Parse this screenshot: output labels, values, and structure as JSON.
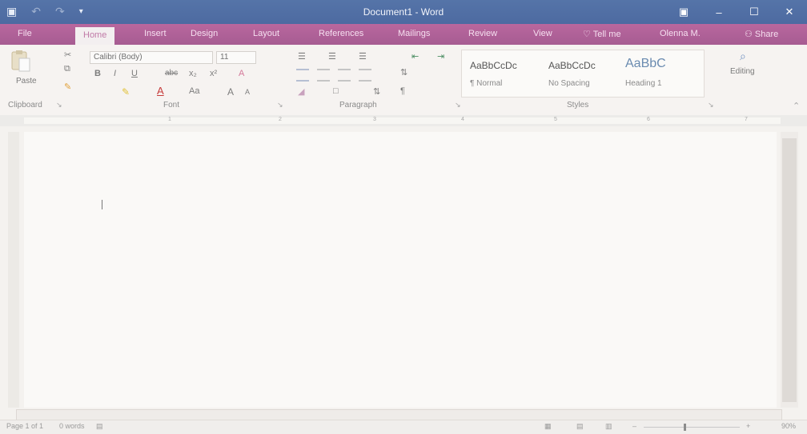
{
  "window": {
    "title": "Document1 - Word",
    "qat_save_icon": "▣",
    "qat_undo_icon": "↶",
    "qat_redo_icon": "↷",
    "qat_more_icon": "▾",
    "minimize_icon": "–",
    "restore_icon": "☐",
    "close_icon": "✕",
    "ribbon_display_icon": "▣"
  },
  "tabs": [
    "File",
    "Home",
    "Insert",
    "Design",
    "Layout",
    "References",
    "Mailings",
    "Review",
    "View"
  ],
  "tell_me": "♡ Tell me",
  "user": "Olenna M.",
  "share": "⚇ Share",
  "clipboard": {
    "paste": "Paste",
    "group": "Clipboard"
  },
  "font": {
    "name": "Calibri (Body)",
    "size": "11",
    "bold": "B",
    "italic": "I",
    "underline": "U",
    "strike": "abc",
    "sub": "x₂",
    "sup": "x²",
    "clear": "A",
    "case": "Aa",
    "grow": "A",
    "shrink": "A",
    "group": "Font"
  },
  "paragraph": {
    "bullets": "☰",
    "numbering": "☰",
    "multilevel": "☰",
    "outdent": "⇤",
    "indent": "⇥",
    "pilcrow": "¶",
    "sort": "⇅",
    "group": "Paragraph"
  },
  "styles": {
    "items": [
      {
        "preview": "AaBbCcDc",
        "name": "¶ Normal"
      },
      {
        "preview": "AaBbCcDc",
        "name": "No Spacing"
      },
      {
        "preview": "AaBbC",
        "name": "Heading 1"
      }
    ],
    "group": "Styles"
  },
  "editing": {
    "label": "Editing",
    "icon": "⌕"
  },
  "ruler_ticks": [
    "1",
    "2",
    "3",
    "4",
    "5",
    "6",
    "7"
  ],
  "status": {
    "page": "Page 1 of 1",
    "words": "0 words",
    "zoom": "90%",
    "zoom_minus": "–",
    "zoom_plus": "+"
  },
  "colors": {
    "titlebar": "#5574a8",
    "ribbon_tabs": "#b9679e",
    "active_tab_text": "#c07aa7"
  }
}
